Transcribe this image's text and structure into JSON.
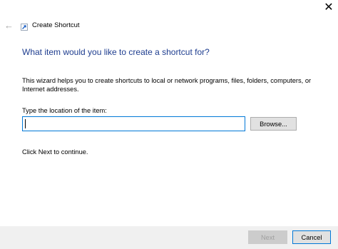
{
  "window": {
    "title": "Create Shortcut",
    "close_glyph": "✕",
    "back_glyph": "←"
  },
  "wizard": {
    "heading": "What item would you like to create a shortcut for?",
    "description": "This wizard helps you to create shortcuts to local or network programs, files, folders, computers, or Internet addresses.",
    "location_label": "Type the location of the item:",
    "location_value": "",
    "browse_label": "Browse...",
    "continue_text": "Click Next to continue."
  },
  "footer": {
    "next_label": "Next",
    "cancel_label": "Cancel"
  },
  "colors": {
    "heading": "#1e3d8f",
    "focus_border": "#0078d7",
    "footer_bg": "#f0f0f0",
    "disabled_text": "#a0a0a0"
  }
}
